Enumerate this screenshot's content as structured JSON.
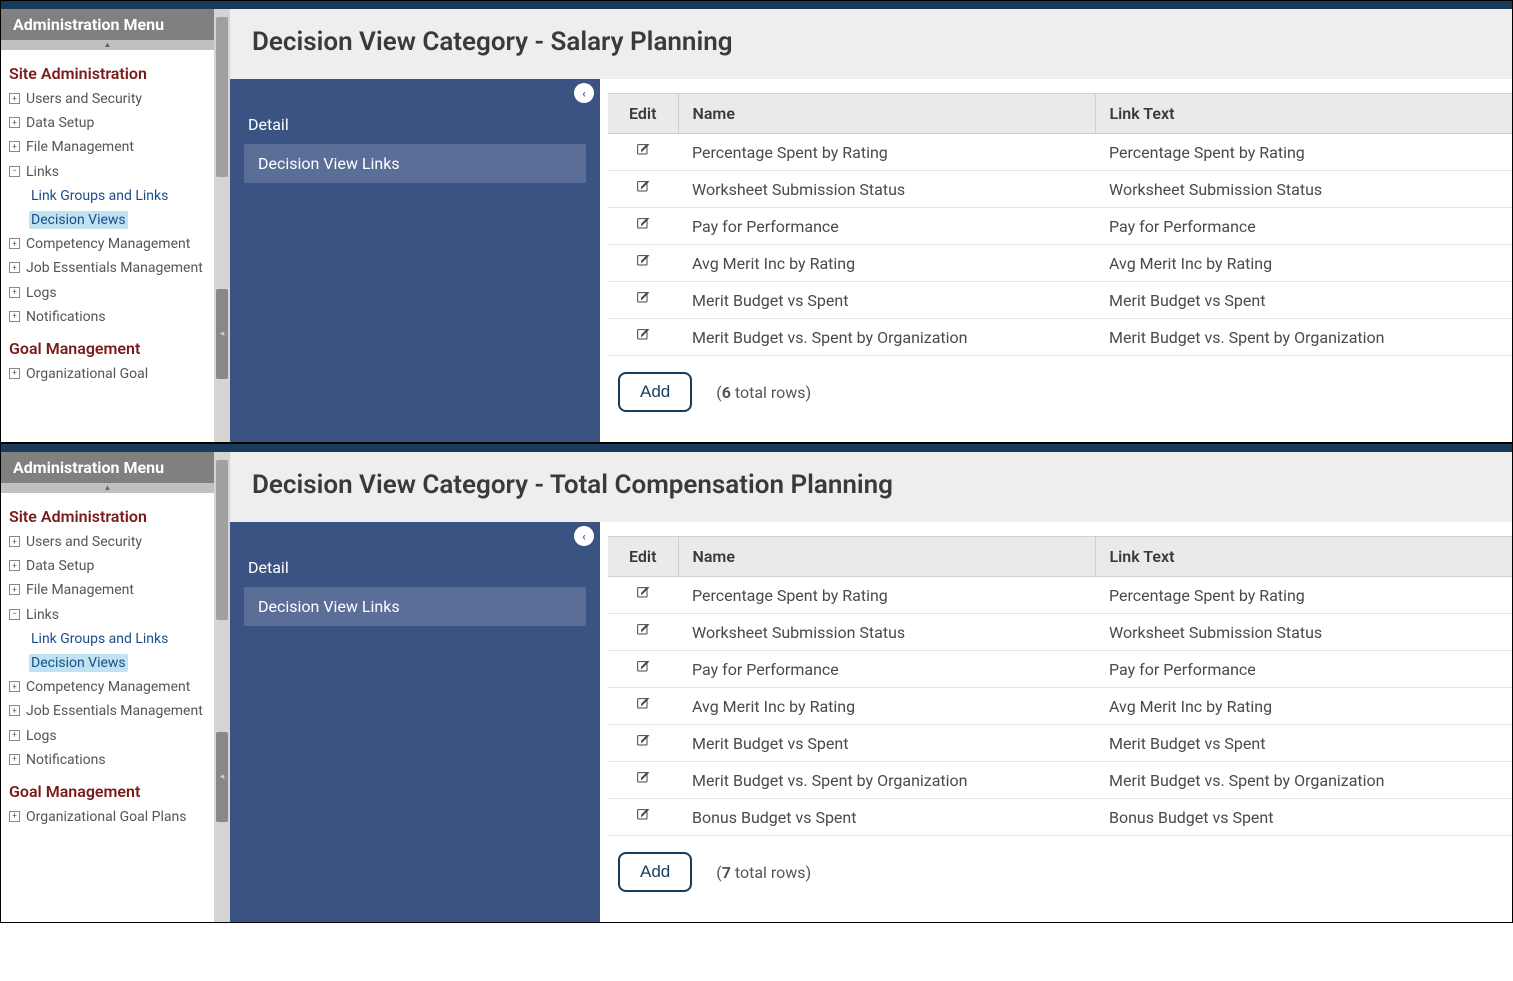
{
  "sidebar": {
    "header": "Administration Menu",
    "sections": [
      {
        "heading": "Site Administration",
        "items": [
          {
            "label": "Users and Security",
            "icon": "+"
          },
          {
            "label": "Data Setup",
            "icon": "+"
          },
          {
            "label": "File Management",
            "icon": "+"
          },
          {
            "label": "Links",
            "icon": "−",
            "children": [
              {
                "label": "Link Groups and Links",
                "active": false
              },
              {
                "label": "Decision Views",
                "active": true
              }
            ]
          },
          {
            "label": "Competency Management",
            "icon": "+"
          },
          {
            "label": "Job Essentials Management",
            "icon": "+"
          },
          {
            "label": "Logs",
            "icon": "+"
          },
          {
            "label": "Notifications",
            "icon": "+"
          }
        ]
      },
      {
        "heading": "Goal Management",
        "items": [
          {
            "label": "Organizational Goal",
            "icon": "+"
          }
        ]
      }
    ],
    "sections_bottom": [
      {
        "heading": "Site Administration",
        "items": [
          {
            "label": "Users and Security",
            "icon": "+"
          },
          {
            "label": "Data Setup",
            "icon": "+"
          },
          {
            "label": "File Management",
            "icon": "+"
          },
          {
            "label": "Links",
            "icon": "−",
            "children": [
              {
                "label": "Link Groups and Links",
                "active": false
              },
              {
                "label": "Decision Views",
                "active": true
              }
            ]
          },
          {
            "label": "Competency Management",
            "icon": "+"
          },
          {
            "label": "Job Essentials Management",
            "icon": "+"
          },
          {
            "label": "Logs",
            "icon": "+"
          },
          {
            "label": "Notifications",
            "icon": "+"
          }
        ]
      },
      {
        "heading": "Goal Management",
        "items": [
          {
            "label": "Organizational Goal Plans",
            "icon": "+"
          }
        ]
      }
    ]
  },
  "subnav": {
    "title": "Detail",
    "item": "Decision View Links"
  },
  "table": {
    "columns": {
      "edit": "Edit",
      "name": "Name",
      "linkText": "Link Text"
    },
    "add_label": "Add",
    "rows_suffix": " total rows)",
    "rows_prefix": "("
  },
  "panels": [
    {
      "title": "Decision View Category - Salary Planning",
      "count": "6",
      "rows": [
        {
          "name": "Percentage Spent by Rating",
          "link": "Percentage Spent by Rating"
        },
        {
          "name": "Worksheet Submission Status",
          "link": "Worksheet Submission Status"
        },
        {
          "name": "Pay for Performance",
          "link": "Pay for Performance"
        },
        {
          "name": "Avg Merit Inc by Rating",
          "link": "Avg Merit Inc by Rating"
        },
        {
          "name": "Merit Budget vs Spent",
          "link": "Merit Budget vs Spent"
        },
        {
          "name": "Merit Budget vs. Spent by Organization",
          "link": "Merit Budget vs. Spent by Organization"
        }
      ]
    },
    {
      "title": "Decision View Category - Total Compensation Planning",
      "count": "7",
      "rows": [
        {
          "name": "Percentage Spent by Rating",
          "link": "Percentage Spent by Rating"
        },
        {
          "name": "Worksheet Submission Status",
          "link": "Worksheet Submission Status"
        },
        {
          "name": "Pay for Performance",
          "link": "Pay for Performance"
        },
        {
          "name": "Avg Merit Inc by Rating",
          "link": "Avg Merit Inc by Rating"
        },
        {
          "name": "Merit Budget vs Spent",
          "link": "Merit Budget vs Spent"
        },
        {
          "name": "Merit Budget vs. Spent by Organization",
          "link": "Merit Budget vs. Spent by Organization"
        },
        {
          "name": "Bonus Budget vs Spent",
          "link": "Bonus Budget vs Spent"
        }
      ]
    }
  ]
}
